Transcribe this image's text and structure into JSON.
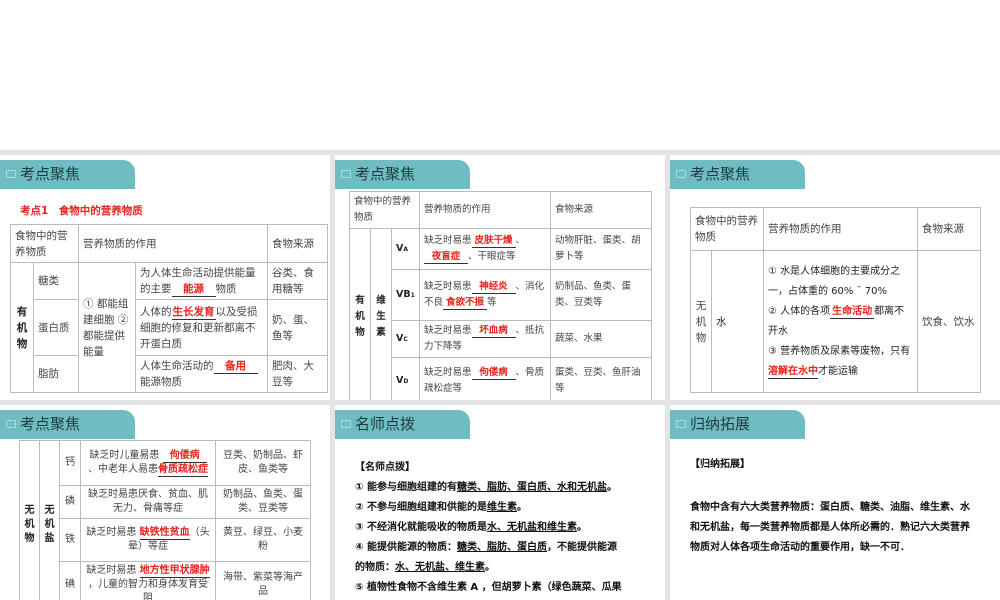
{
  "slides": [
    {
      "tab": "考点聚焦",
      "heading": "考点1　食物中的营养物质",
      "header": [
        "食物中的营养物质",
        "营养物质的作用",
        "食物来源"
      ],
      "group": "有机物",
      "shared": "① 都能组建细胞 ② 都能提供能量",
      "rows": [
        {
          "name": "糖类",
          "pre": "为人体生命活动提供能量的主要",
          "ans": "能源",
          "post": "物质",
          "src": "谷类、食用糖等"
        },
        {
          "name": "蛋白质",
          "pre": "人体的",
          "ans": "生长发育",
          "post": "以及受损细胞的修复和更新都离不开蛋白质",
          "src": "奶、蛋、鱼等"
        },
        {
          "name": "脂肪",
          "pre": "人体生命活动的",
          "ans": "备用",
          "post": "能源物质",
          "src": "肥肉、大豆等"
        }
      ]
    },
    {
      "tab": "考点聚焦",
      "header": [
        "食物中的营养物质",
        "营养物质的作用",
        "食物来源"
      ],
      "group": "有机物",
      "sub": "维生素",
      "rows": [
        {
          "v": "V",
          "s": "A",
          "pre": "缺乏时易患",
          "a1": "皮肤干燥",
          "mid": "、",
          "a2": "夜盲症",
          "post": "、干眼症等",
          "src": "动物肝脏、蛋类、胡萝卜等"
        },
        {
          "v": "VB",
          "s": "1",
          "pre": "缺乏时易患",
          "a1": "神经炎",
          "mid": "、消化不良",
          "a2": "食欲不振",
          "post": "等",
          "src": "奶制品、鱼类、蛋类、豆类等"
        },
        {
          "v": "V",
          "s": "C",
          "pre": "缺乏时易患",
          "a1": "坏血病",
          "post": "、抵抗力下降等",
          "src": "蔬菜、水果"
        },
        {
          "v": "V",
          "s": "D",
          "pre": "缺乏时易患",
          "a1": "佝偻病",
          "post": "、骨质疏松症等",
          "src": "蛋类、豆类、鱼肝油等"
        }
      ]
    },
    {
      "tab": "考点聚焦",
      "header": [
        "食物中的营养物质",
        "营养物质的作用",
        "食物来源"
      ],
      "group": "无机物",
      "name": "水",
      "l1": "① 水是人体细胞的主要成分之一，占体重的 60% ¯ 70%",
      "l2a": "② 人体的各项",
      "a1": "生命活动",
      "l2b": "都离不开水",
      "l3a": "③ 营养物质及尿素等废物，只有",
      "a2": "溶解在水中",
      "l3b": "才能运输",
      "src": "饮食、饮水"
    },
    {
      "tab": "考点聚焦",
      "group": "无机物",
      "sub": "无机盐",
      "rows": [
        {
          "name": "钙",
          "text": "缺乏时儿童易患",
          "a1": "佝偻病",
          "mid": "、中老年人易患",
          "a2": "骨质疏松症",
          "src": "豆类、奶制品、虾皮、鱼类等"
        },
        {
          "name": "磷",
          "text": "缺乏时易患厌食、贫血、肌无力、骨痛等症",
          "src": "奶制品、鱼类、蛋类、豆类等"
        },
        {
          "name": "铁",
          "text": "缺乏时易患",
          "a1": "缺铁性贫血",
          "mid": "（头晕）等症",
          "src": "黄豆、绿豆、小麦粉"
        },
        {
          "name": "碘",
          "text": "缺乏时易患",
          "a1": "地方性甲状腺肿",
          "mid": "，儿童的智力和身体发育受阻",
          "src": "海带、紫菜等海产品"
        }
      ]
    },
    {
      "tab": "名师点拨",
      "title": "【名师点拨】",
      "lines": [
        {
          "pre": "① 能参与细胞组建的有",
          "u": "糖类、脂肪、蛋白质、水和无机盐",
          "post": "。"
        },
        {
          "pre": "② 不参与细胞组建和供能的是",
          "u": "维生素",
          "post": "。"
        },
        {
          "pre": "③ 不经消化就能吸收的物质是",
          "u": "水、无机盐和维生素",
          "post": "。"
        },
        {
          "pre": "④ 能提供能源的物质：",
          "u": "糖类、脂肪、蛋白质",
          "post": "，不能提供能源"
        },
        {
          "pre": "的物质：",
          "u": "水、无机盐、维生素",
          "post": "。"
        },
        {
          "pre": "⑤ 植物性食物不含维生素 A ，但胡萝卜素（绿色蔬菜、瓜果",
          "u": "",
          "post": ""
        }
      ]
    },
    {
      "tab": "归纳拓展",
      "title": "【归纳拓展】",
      "body": "食物中含有六大类营养物质：蛋白质、糖类、油脂、维生素、水和无机盐，每一类营养物质都是人体所必需的．熟记六大类营养物质对人体各项生命活动的重要作用，缺一不可．"
    }
  ]
}
